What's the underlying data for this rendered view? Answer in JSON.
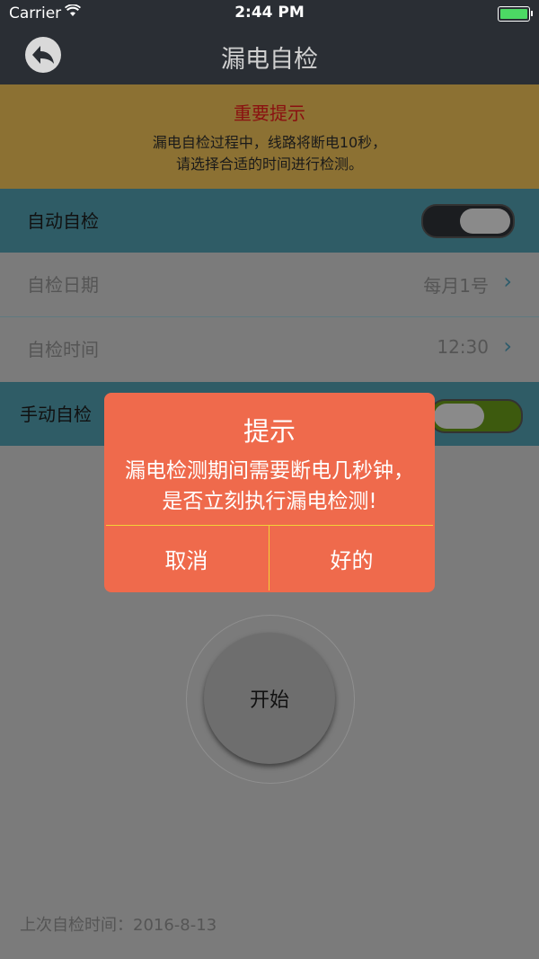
{
  "status_bar": {
    "carrier": "Carrier",
    "time": "2:44 PM"
  },
  "nav": {
    "title": "漏电自检"
  },
  "notice": {
    "title": "重要提示",
    "line1": "漏电自检过程中，线路将断电10秒，",
    "line2": "请选择合适的时间进行检测。"
  },
  "auto_check": {
    "label": "自动自检",
    "enabled": true
  },
  "check_date": {
    "label": "自检日期",
    "value": "每月1号"
  },
  "check_time": {
    "label": "自检时间",
    "value": "12:30"
  },
  "manual_check": {
    "label": "手动自检",
    "enabled": true
  },
  "start_button": {
    "label": "开始"
  },
  "last_check": {
    "text": "上次自检时间：2016-8-13"
  },
  "dialog": {
    "title": "提示",
    "message": "漏电检测期间需要断电几秒钟，是否立刻执行漏电检测!",
    "cancel_label": "取消",
    "ok_label": "好的"
  },
  "colors": {
    "dialog_bg": "#ef6a4c",
    "divider": "#f3d238",
    "nav_bg": "#2a2e34"
  }
}
